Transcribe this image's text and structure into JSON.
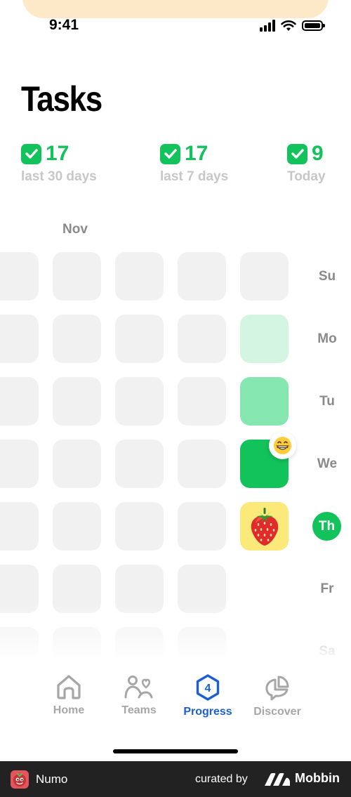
{
  "status_bar": {
    "time": "9:41"
  },
  "page": {
    "title": "Tasks"
  },
  "stats": [
    {
      "value": "17",
      "label": "last 30 days"
    },
    {
      "value": "17",
      "label": "last 7 days"
    },
    {
      "value": "9",
      "label": "Today"
    }
  ],
  "calendar": {
    "month": "Nov",
    "days": [
      "Su",
      "Mo",
      "Tu",
      "We",
      "Th",
      "Fr",
      "Sa"
    ],
    "today": "Th",
    "latest_week_activity": [
      {
        "day": "Su",
        "level": "none"
      },
      {
        "day": "Mo",
        "level": "light"
      },
      {
        "day": "Tu",
        "level": "medium"
      },
      {
        "day": "We",
        "level": "full",
        "badge": "😁"
      },
      {
        "day": "Th",
        "level": "strawberry"
      }
    ]
  },
  "tabbar": {
    "items": [
      {
        "label": "Home",
        "icon": "house-icon",
        "active": false
      },
      {
        "label": "Teams",
        "icon": "people-heart-icon",
        "active": false
      },
      {
        "label": "Progress",
        "icon": "progress-hexagon-icon",
        "active": true,
        "badge": "4"
      },
      {
        "label": "Discover",
        "icon": "discover-blob-icon",
        "active": false
      }
    ]
  },
  "footer": {
    "app_name": "Numo",
    "curated_by": "curated by",
    "brand": "Mobbin"
  },
  "colors": {
    "accent_green": "#12c25a",
    "green_light": "#d3f5e1",
    "green_medium": "#86e6b0",
    "active_tab": "#1c5fd1",
    "cell_empty": "#f1f1f1",
    "strawberry_bg": "#fbe97a"
  }
}
